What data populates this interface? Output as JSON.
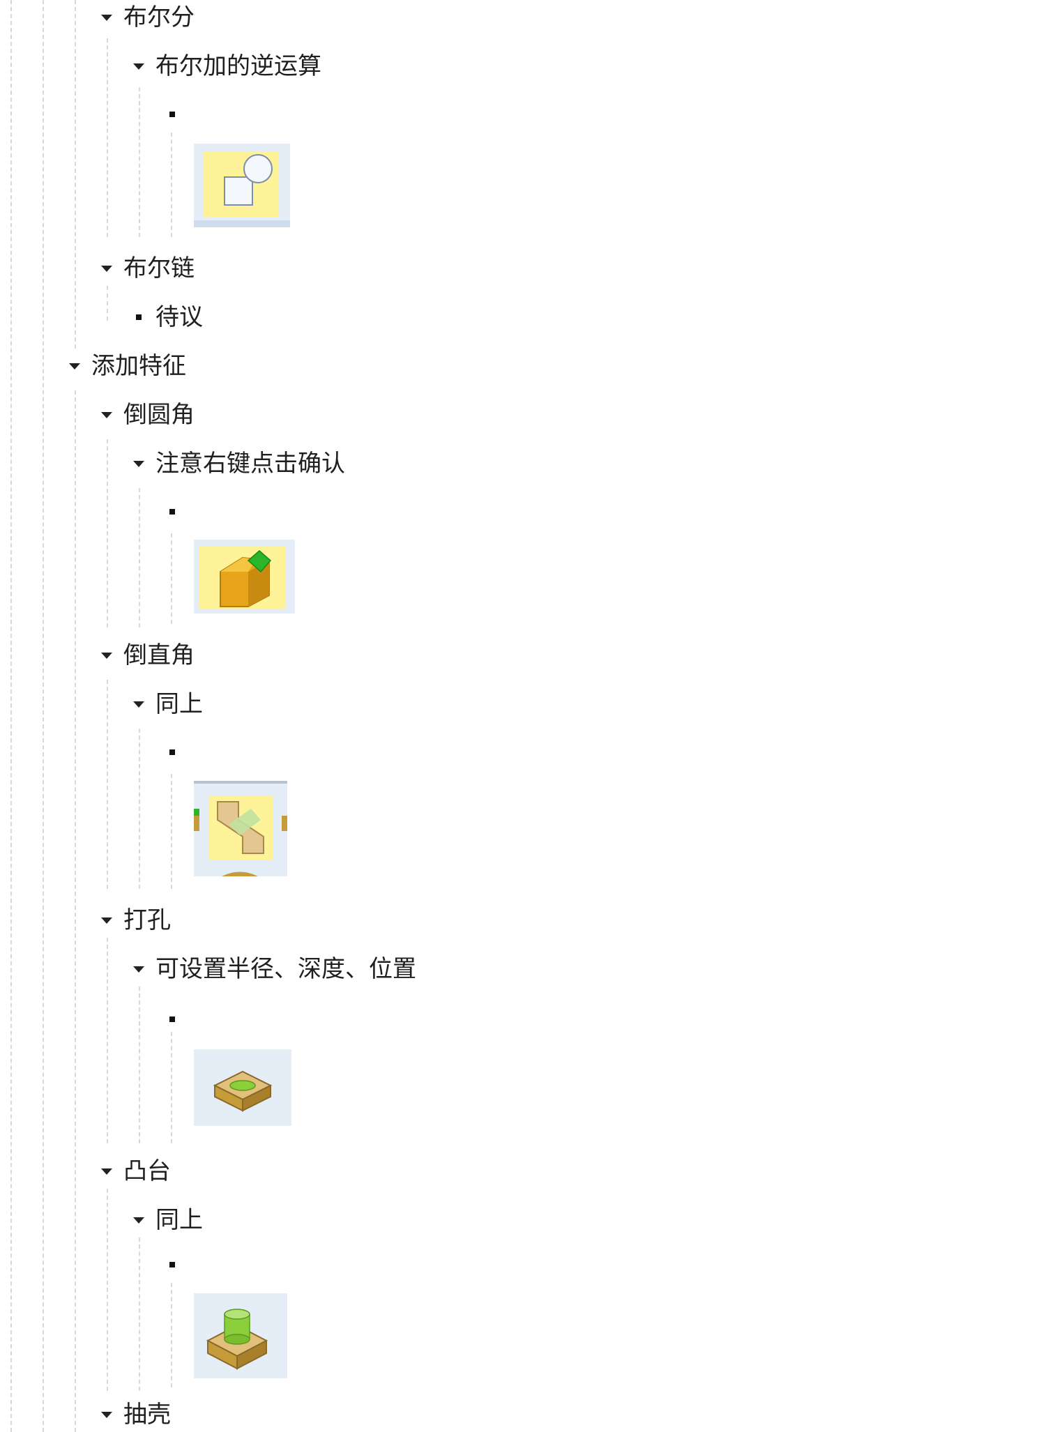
{
  "tree": {
    "n1": "布尔分",
    "n1a": "布尔加的逆运算",
    "n2": "布尔链",
    "n2a": "待议",
    "root": "添加特征",
    "c1": "倒圆角",
    "c1a": "注意右键点击确认",
    "c2": "倒直角",
    "c2a": "同上",
    "c3": "打孔",
    "c3a": "可设置半径、深度、位置",
    "c4": "凸台",
    "c4a": "同上",
    "c5": "抽壳"
  },
  "icons": {
    "img1": "boolean-subtract-icon",
    "img2": "fillet-icon",
    "img3": "chamfer-icon",
    "img4": "hole-icon",
    "img5": "boss-icon"
  },
  "colors": {
    "highlight": "#fff39a",
    "thumb_bg": "#e5edf7"
  }
}
